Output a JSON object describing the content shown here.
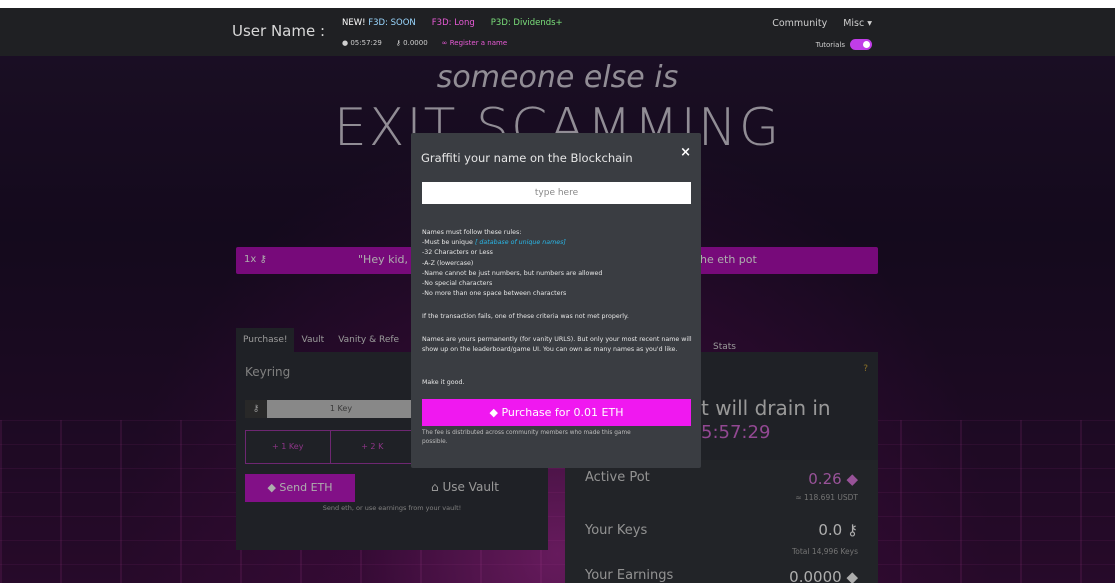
{
  "navbar": {
    "username_label": "User Name :",
    "links": {
      "new_prefix": "NEW!",
      "new_label": "F3D: SOON",
      "long_label": "F3D: Long",
      "dividends_label": "P3D: Dividends+"
    },
    "stats": {
      "timer_icon": "bomb-icon",
      "timer": "05:57:29",
      "keys_icon": "key-icon",
      "keys": "0.0000",
      "register_label": "Register a name"
    },
    "community_label": "Community",
    "misc_label": "Misc ▾",
    "tutorials_label": "Tutorials"
  },
  "hero": {
    "line1": "someone else is",
    "line2": "EXIT SCAMMING"
  },
  "banner": {
    "key_label": "1x",
    "quote_start": "\"Hey kid, b",
    "quote_end": "he eth pot"
  },
  "tabs": {
    "purchase": "Purchase!",
    "vault": "Vault",
    "vanity": "Vanity & Refe",
    "stats": "Stats"
  },
  "left_panel": {
    "title": "Keyring",
    "key_input": "1 Key",
    "add_buttons": [
      "+ 1 Key",
      "+ 2 K"
    ],
    "send_label": "Send ETH",
    "vault_label": "Use Vault",
    "note": "Send eth, or use earnings from your vault!"
  },
  "right_panel": {
    "question": "?",
    "drain_text": "t will drain in",
    "drain_time": "5:57:29",
    "active_pot_label": "Active Pot",
    "active_pot_value": "0.26",
    "active_pot_usd": "≈ 118.691 USDT",
    "your_keys_label": "Your Keys",
    "your_keys_value": "0.0",
    "total_keys": "Total 14,996 Keys",
    "your_earnings_label": "Your Earnings",
    "your_earnings_value": "0.0000"
  },
  "modal": {
    "title": "Graffiti your name on the Blockchain",
    "close": "×",
    "input_placeholder": "type here",
    "rules_intro": "Names must follow these rules:",
    "rule_unique_prefix": "-Must be unique",
    "rule_unique_link": "[ database of unique names]",
    "rules": [
      "-32 Characters or Less",
      "-A-Z (lowercase)",
      "-Name cannot be just numbers, but numbers are allowed",
      "-No special characters",
      "-No more than one space between characters"
    ],
    "fail_note": "If the transaction fails, one of these criteria was not met properly.",
    "perm_note": "Names are yours permanently (for vanity URLS). But only your most recent name will show up on the leaderboard/game UI. You can own as many names as you'd like.",
    "make_good": "Make it good.",
    "purchase_label": "Purchase for 0.01 ETH",
    "fee_note": "The fee is distributed across community members who made this game possible."
  },
  "colors": {
    "accent": "#f018f0",
    "banner": "#b010b4",
    "panel": "#2f3238",
    "modal": "#3a3d42"
  }
}
